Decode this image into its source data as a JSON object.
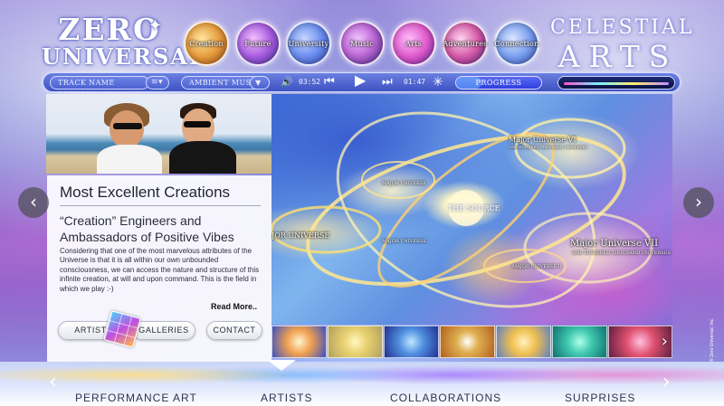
{
  "header": {
    "logo_line1": "ZERO",
    "logo_line2": "UNIVERSAL.",
    "title_line1": "CELESTIAL",
    "title_line2": "ARTS",
    "orbs": [
      {
        "label": "Creation"
      },
      {
        "label": "Future"
      },
      {
        "label": "University"
      },
      {
        "label": "Music"
      },
      {
        "label": "Arts"
      },
      {
        "label": "Adventures"
      },
      {
        "label": "Connection"
      }
    ]
  },
  "mediabar": {
    "track_placeholder": "TRACK NAME SCROLL...",
    "list_icon": "≡▾",
    "ambient_label": "AMBIENT MUSIC",
    "ambient_arrow": "▼",
    "volume_icon": "🔊",
    "elapsed": "03:52",
    "rewind_icon": "⏮",
    "play_icon": "▶",
    "forward_icon": "⏭",
    "remaining": "01:47",
    "star_icon": "✳",
    "progress_label": "PROGRESS",
    "progress_value": 0.3
  },
  "panel": {
    "title": "Most Excellent Creations",
    "subtitle": "“Creation” Engineers and Ambassadors of Positive Vibes",
    "body": "Considering that one of the most marvelous attributes of the Universe is that it is all within our own unbounded consciousness, we can access the nature and structure of this infinite creation, at will and upon command.      This is the field in which we play :-)",
    "read_more": "Read More..",
    "btn_artist": "ARTIST",
    "btn_galleries": "GALLERIES",
    "btn_contact": "CONTACT"
  },
  "map": {
    "label_vi": "Major Universe VI",
    "label_vi_sub": "ONE HUNDRED THOUSAND UNIVERSES",
    "label_vii": "Major Universe VII",
    "label_vii_sub": "ONE HUNDRED THOUSAND UNIVERSES",
    "label_source": "THE SOURCE",
    "label_i": "MAJOR UNIVERSE",
    "label_or": "JOR UNIVERSE",
    "label_u": "MAJOR UNIVERSE",
    "label_ii": "MAJOR UNIVERSE II"
  },
  "thumbs": {
    "next_icon": "›"
  },
  "side": {
    "prev_icon": "‹",
    "next_icon": "›"
  },
  "bottom": {
    "left_arrow": "‹",
    "right_arrow": "›",
    "items": [
      "PERFORMANCE ART",
      "ARTISTS",
      "COLLABORATIONS",
      "SURPRISES"
    ]
  },
  "copyright": "© Zero Universal, Inc."
}
